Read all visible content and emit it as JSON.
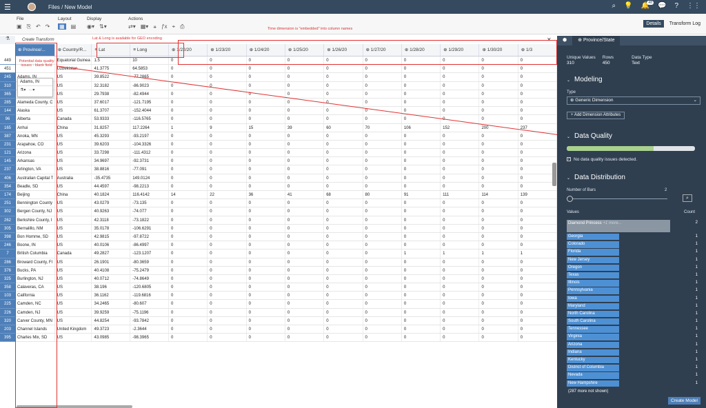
{
  "topbar": {
    "breadcrumb": "Files  /  New Model",
    "notification_count": "48"
  },
  "toolbar": {
    "groups": [
      {
        "label": "File"
      },
      {
        "label": "Layout"
      },
      {
        "label": "Display"
      },
      {
        "label": "Actions"
      }
    ],
    "details_label": "Details",
    "transform_log_label": "Transform Log"
  },
  "annotations": {
    "time_dimension": "Time dimension is \"embedded\" into column names",
    "lat_long": "Lat & Long is available for GEO encoding",
    "data_quality": "Potential data quality issues - blank field"
  },
  "grid": {
    "create_transform": "Create Transform",
    "columns": [
      "Province/...",
      "Country/R...",
      "Lat",
      "Long",
      "1/22/20",
      "1/23/20",
      "1/24/20",
      "1/25/20",
      "1/26/20",
      "1/27/20",
      "1/28/20",
      "1/29/20",
      "1/30/20",
      "1/3"
    ],
    "row_numbers": [
      "449",
      "451",
      "245",
      "310",
      "365",
      "285",
      "144",
      "96",
      "165",
      "387",
      "231",
      "121",
      "145",
      "237",
      "406",
      "354",
      "174",
      "251",
      "302",
      "262",
      "305",
      "398",
      "246",
      "7",
      "286",
      "376",
      "325",
      "358",
      "103",
      "225",
      "226",
      "320",
      "203",
      "395"
    ],
    "rows": [
      [
        "",
        "Equatorial Guinea",
        "1.5",
        "10",
        "0",
        "0",
        "0",
        "0",
        "0",
        "0",
        "0",
        "0",
        "0",
        "0"
      ],
      [
        "",
        "Uzbekistan",
        "41.3775",
        "64.5853",
        "0",
        "0",
        "0",
        "0",
        "0",
        "0",
        "0",
        "0",
        "0",
        "0"
      ],
      [
        "Adams, IN",
        "US",
        "39.8522",
        "-77.2865",
        "0",
        "0",
        "0",
        "0",
        "0",
        "0",
        "0",
        "0",
        "0",
        "0"
      ],
      [
        "Adams, WI",
        "US",
        "32.3182",
        "-86.9023",
        "0",
        "0",
        "0",
        "0",
        "0",
        "0",
        "0",
        "0",
        "0",
        "0"
      ],
      [
        "Alachua, FL",
        "US",
        "29.7938",
        "-82.4944",
        "0",
        "0",
        "0",
        "0",
        "0",
        "0",
        "0",
        "0",
        "0",
        "0"
      ],
      [
        "Alameda County, C",
        "US",
        "37.6017",
        "-121.7195",
        "0",
        "0",
        "0",
        "0",
        "0",
        "0",
        "0",
        "0",
        "0",
        "0"
      ],
      [
        "Alaska",
        "US",
        "61.3707",
        "-152.4044",
        "0",
        "0",
        "0",
        "0",
        "0",
        "0",
        "0",
        "0",
        "0",
        "0"
      ],
      [
        "Alberta",
        "Canada",
        "53.9333",
        "-116.5765",
        "0",
        "0",
        "0",
        "0",
        "0",
        "0",
        "0",
        "0",
        "0",
        "0"
      ],
      [
        "Anhui",
        "China",
        "31.8257",
        "117.2264",
        "1",
        "9",
        "15",
        "39",
        "60",
        "70",
        "106",
        "152",
        "200",
        "237"
      ],
      [
        "Anoka, MN",
        "US",
        "45.3293",
        "-93.2197",
        "0",
        "0",
        "0",
        "0",
        "0",
        "0",
        "0",
        "0",
        "0",
        "0"
      ],
      [
        "Arapahoe, CO",
        "US",
        "39.6203",
        "-104.3326",
        "0",
        "0",
        "0",
        "0",
        "0",
        "0",
        "0",
        "0",
        "0",
        "0"
      ],
      [
        "Arizona",
        "US",
        "33.7298",
        "-111.4312",
        "0",
        "0",
        "0",
        "0",
        "0",
        "0",
        "0",
        "0",
        "0",
        "0"
      ],
      [
        "Arkansas",
        "US",
        "34.9697",
        "-92.3731",
        "0",
        "0",
        "0",
        "0",
        "0",
        "0",
        "0",
        "0",
        "0",
        "0"
      ],
      [
        "Arlington, VA",
        "US",
        "38.8816",
        "-77.091",
        "0",
        "0",
        "0",
        "0",
        "0",
        "0",
        "0",
        "0",
        "0",
        "0"
      ],
      [
        "Australian Capital T",
        "Australia",
        "-35.4735",
        "149.0124",
        "0",
        "0",
        "0",
        "0",
        "0",
        "0",
        "0",
        "0",
        "0",
        "0"
      ],
      [
        "Beadle, SD",
        "US",
        "44.4597",
        "-98.2213",
        "0",
        "0",
        "0",
        "0",
        "0",
        "0",
        "0",
        "0",
        "0",
        "0"
      ],
      [
        "Beijing",
        "China",
        "40.1824",
        "116.4142",
        "14",
        "22",
        "36",
        "41",
        "68",
        "80",
        "91",
        "111",
        "114",
        "139"
      ],
      [
        "Bennington County",
        "US",
        "43.0279",
        "-73.135",
        "0",
        "0",
        "0",
        "0",
        "0",
        "0",
        "0",
        "0",
        "0",
        "0"
      ],
      [
        "Bergen County, NJ",
        "US",
        "40.9263",
        "-74.077",
        "0",
        "0",
        "0",
        "0",
        "0",
        "0",
        "0",
        "0",
        "0",
        "0"
      ],
      [
        "Berkshire County, I",
        "US",
        "42.3118",
        "-73.1822",
        "0",
        "0",
        "0",
        "0",
        "0",
        "0",
        "0",
        "0",
        "0",
        "0"
      ],
      [
        "Bernalillo, NM",
        "US",
        "35.0178",
        "-106.6291",
        "0",
        "0",
        "0",
        "0",
        "0",
        "0",
        "0",
        "0",
        "0",
        "0"
      ],
      [
        "Bon Homme, SD",
        "US",
        "42.9815",
        "-97.8722",
        "0",
        "0",
        "0",
        "0",
        "0",
        "0",
        "0",
        "0",
        "0",
        "0"
      ],
      [
        "Boone, IN",
        "US",
        "40.0106",
        "-86.4997",
        "0",
        "0",
        "0",
        "0",
        "0",
        "0",
        "0",
        "0",
        "0",
        "0"
      ],
      [
        "British Columbia",
        "Canada",
        "49.2827",
        "-123.1207",
        "0",
        "0",
        "0",
        "0",
        "0",
        "0",
        "1",
        "1",
        "1",
        "1"
      ],
      [
        "Broward County, Fl",
        "US",
        "26.1901",
        "-80.3659",
        "0",
        "0",
        "0",
        "0",
        "0",
        "0",
        "0",
        "0",
        "0",
        "0"
      ],
      [
        "Bucks, PA",
        "US",
        "40.4108",
        "-75.2479",
        "0",
        "0",
        "0",
        "0",
        "0",
        "0",
        "0",
        "0",
        "0",
        "0"
      ],
      [
        "Burlington, NJ",
        "US",
        "40.0712",
        "-74.8649",
        "0",
        "0",
        "0",
        "0",
        "0",
        "0",
        "0",
        "0",
        "0",
        "0"
      ],
      [
        "Calaveras, CA",
        "US",
        "38.196",
        "-120.6805",
        "0",
        "0",
        "0",
        "0",
        "0",
        "0",
        "0",
        "0",
        "0",
        "0"
      ],
      [
        "California",
        "US",
        "36.1162",
        "-119.6816",
        "0",
        "0",
        "0",
        "0",
        "0",
        "0",
        "0",
        "0",
        "0",
        "0"
      ],
      [
        "Camden, NC",
        "US",
        "34.2465",
        "-80.607",
        "0",
        "0",
        "0",
        "0",
        "0",
        "0",
        "0",
        "0",
        "0",
        "0"
      ],
      [
        "Camden, NJ",
        "US",
        "39.9259",
        "-75.1196",
        "0",
        "0",
        "0",
        "0",
        "0",
        "0",
        "0",
        "0",
        "0",
        "0"
      ],
      [
        "Carver County, MN",
        "US",
        "44.8254",
        "-93.7842",
        "0",
        "0",
        "0",
        "0",
        "0",
        "0",
        "0",
        "0",
        "0",
        "0"
      ],
      [
        "Channel Islands",
        "United Kingdom",
        "49.3723",
        "-2.3644",
        "0",
        "0",
        "0",
        "0",
        "0",
        "0",
        "0",
        "0",
        "0",
        "0"
      ],
      [
        "Charles Mix, SD",
        "US",
        "43.0985",
        "-98.3965",
        "0",
        "0",
        "0",
        "0",
        "0",
        "0",
        "0",
        "0",
        "0",
        "0"
      ]
    ]
  },
  "panel": {
    "tab_icon": "cube-icon",
    "tab_label": "Province/State",
    "stats": {
      "unique_label": "Unique Values",
      "unique_value": "310",
      "rows_label": "Rows",
      "rows_value": "450",
      "type_label": "Data Type",
      "type_value": "Text"
    },
    "modeling_title": "Modeling",
    "type_label": "Type",
    "type_value": "Generic Dimension",
    "add_attr_label": "+ Add Dimension Attributes",
    "quality_title": "Data Quality",
    "quality_fraction": 0.68,
    "quality_check": "No data quality issues detected.",
    "distribution_title": "Data Distribution",
    "bars_label": "Number of Bars",
    "bars_value": "2",
    "values_label": "Values",
    "count_label": "Count",
    "first_value": "Diamond Princess",
    "first_more": "+1 more...",
    "first_count": "2",
    "values": [
      "Georgia",
      "Colorado",
      "Florida",
      "New Jersey",
      "Oregon",
      "Texas",
      "Illinois",
      "Pennsylvania",
      "Iowa",
      "Maryland",
      "North Carolina",
      "South Carolina",
      "Tennessee",
      "Virginia",
      "Arizona",
      "Indiana",
      "Kentucky",
      "District of Columbia",
      "Nevada",
      "New Hampshire"
    ],
    "value_count": "1",
    "not_shown": "(287 more not shown)",
    "create_model": "Create Model"
  }
}
